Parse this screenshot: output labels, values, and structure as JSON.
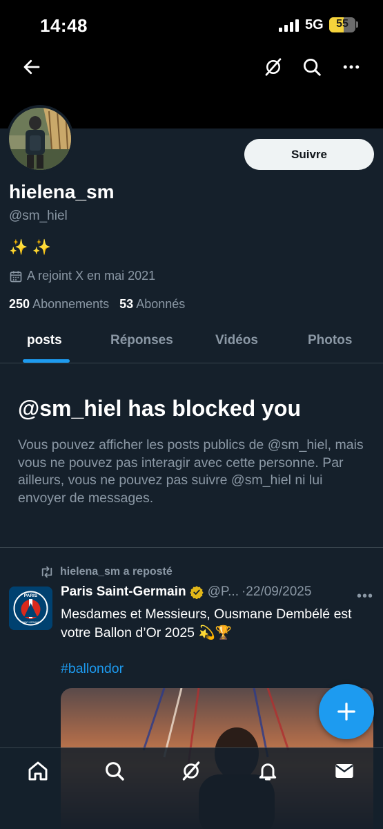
{
  "status_bar": {
    "time": "14:48",
    "network": "5G",
    "battery": "55",
    "battery_level": 0.55
  },
  "header": {
    "back_icon": "arrow-left-icon",
    "grok_icon": "grok-icon",
    "search_icon": "search-icon",
    "more_icon": "more-horizontal-icon"
  },
  "profile": {
    "follow_label": "Suivre",
    "display_name": "hielena_sm",
    "handle": "@sm_hiel",
    "bio": "✨ ✨",
    "joined": "A rejoint X en mai 2021",
    "following_count": "250",
    "following_label": "Abonnements",
    "followers_count": "53",
    "followers_label": "Abonnés"
  },
  "tabs": [
    {
      "label": "posts",
      "active": true
    },
    {
      "label": "Réponses",
      "active": false
    },
    {
      "label": "Vidéos",
      "active": false
    },
    {
      "label": "Photos",
      "active": false
    }
  ],
  "blocked": {
    "title": "@sm_hiel has blocked you",
    "message": "Vous pouvez afficher les posts publics de @sm_hiel, mais vous ne pouvez pas interagir avec cette personne. Par ailleurs, vous ne pouvez pas suivre @sm_hiel ni lui envoyer de messages."
  },
  "post": {
    "repost_label": "hielena_sm a reposté",
    "author": "Paris Saint-Germain",
    "handle": "@P...",
    "date": "·22/09/2025",
    "text": "Mesdames et Messieurs, Ousmane Dembélé est votre Ballon d’Or 2025 💫🏆",
    "hashtag": "#ballondor",
    "avatar_text": "PARIS",
    "avatar_text_2": "SAINT-GERMAIN"
  },
  "bottom_nav": [
    "home-icon",
    "search-icon",
    "grok-icon",
    "notifications-icon",
    "messages-icon"
  ],
  "colors": {
    "accent": "#1d9bf0",
    "background": "#15202b",
    "muted": "#8b98a5"
  }
}
